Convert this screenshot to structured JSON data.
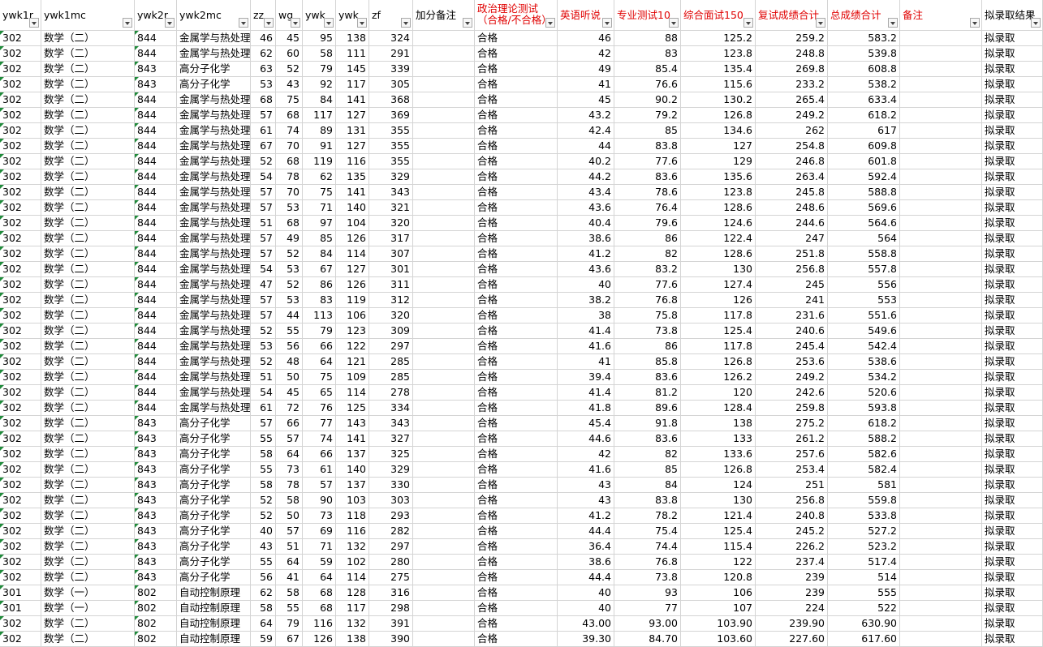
{
  "columns": [
    {
      "label": "ywk1r",
      "red": false
    },
    {
      "label": "ywk1mc",
      "red": false
    },
    {
      "label": "ywk2r",
      "red": false
    },
    {
      "label": "ywk2mc",
      "red": false
    },
    {
      "label": "zz",
      "red": false
    },
    {
      "label": "wg",
      "red": false
    },
    {
      "label": "ywk",
      "red": false
    },
    {
      "label": "ywk",
      "red": false
    },
    {
      "label": "zf",
      "red": false
    },
    {
      "label": "加分备注",
      "red": false
    },
    {
      "label": "政治理论测试（合格/不合格）",
      "red": true,
      "wrap": true
    },
    {
      "label": "英语听说",
      "red": true
    },
    {
      "label": "专业测试10",
      "red": true
    },
    {
      "label": "综合面试150",
      "red": true
    },
    {
      "label": "复试成绩合计",
      "red": true
    },
    {
      "label": "总成绩合计",
      "red": true
    },
    {
      "label": "备注",
      "red": true
    },
    {
      "label": "拟录取结果",
      "red": false
    }
  ],
  "rows": [
    [
      "302",
      "数学（二）",
      "844",
      "金属学与热处理",
      "46",
      "45",
      "95",
      "138",
      "324",
      "",
      "合格",
      "46",
      "88",
      "125.2",
      "259.2",
      "583.2",
      "",
      "拟录取"
    ],
    [
      "302",
      "数学（二）",
      "844",
      "金属学与热处理",
      "62",
      "60",
      "58",
      "111",
      "291",
      "",
      "合格",
      "42",
      "83",
      "123.8",
      "248.8",
      "539.8",
      "",
      "拟录取"
    ],
    [
      "302",
      "数学（二）",
      "843",
      "高分子化学",
      "63",
      "52",
      "79",
      "145",
      "339",
      "",
      "合格",
      "49",
      "85.4",
      "135.4",
      "269.8",
      "608.8",
      "",
      "拟录取"
    ],
    [
      "302",
      "数学（二）",
      "843",
      "高分子化学",
      "53",
      "43",
      "92",
      "117",
      "305",
      "",
      "合格",
      "41",
      "76.6",
      "115.6",
      "233.2",
      "538.2",
      "",
      "拟录取"
    ],
    [
      "302",
      "数学（二）",
      "844",
      "金属学与热处理",
      "68",
      "75",
      "84",
      "141",
      "368",
      "",
      "合格",
      "45",
      "90.2",
      "130.2",
      "265.4",
      "633.4",
      "",
      "拟录取"
    ],
    [
      "302",
      "数学（二）",
      "844",
      "金属学与热处理",
      "57",
      "68",
      "117",
      "127",
      "369",
      "",
      "合格",
      "43.2",
      "79.2",
      "126.8",
      "249.2",
      "618.2",
      "",
      "拟录取"
    ],
    [
      "302",
      "数学（二）",
      "844",
      "金属学与热处理",
      "61",
      "74",
      "89",
      "131",
      "355",
      "",
      "合格",
      "42.4",
      "85",
      "134.6",
      "262",
      "617",
      "",
      "拟录取"
    ],
    [
      "302",
      "数学（二）",
      "844",
      "金属学与热处理",
      "67",
      "70",
      "91",
      "127",
      "355",
      "",
      "合格",
      "44",
      "83.8",
      "127",
      "254.8",
      "609.8",
      "",
      "拟录取"
    ],
    [
      "302",
      "数学（二）",
      "844",
      "金属学与热处理",
      "52",
      "68",
      "119",
      "116",
      "355",
      "",
      "合格",
      "40.2",
      "77.6",
      "129",
      "246.8",
      "601.8",
      "",
      "拟录取"
    ],
    [
      "302",
      "数学（二）",
      "844",
      "金属学与热处理",
      "54",
      "78",
      "62",
      "135",
      "329",
      "",
      "合格",
      "44.2",
      "83.6",
      "135.6",
      "263.4",
      "592.4",
      "",
      "拟录取"
    ],
    [
      "302",
      "数学（二）",
      "844",
      "金属学与热处理",
      "57",
      "70",
      "75",
      "141",
      "343",
      "",
      "合格",
      "43.4",
      "78.6",
      "123.8",
      "245.8",
      "588.8",
      "",
      "拟录取"
    ],
    [
      "302",
      "数学（二）",
      "844",
      "金属学与热处理",
      "57",
      "53",
      "71",
      "140",
      "321",
      "",
      "合格",
      "43.6",
      "76.4",
      "128.6",
      "248.6",
      "569.6",
      "",
      "拟录取"
    ],
    [
      "302",
      "数学（二）",
      "844",
      "金属学与热处理",
      "51",
      "68",
      "97",
      "104",
      "320",
      "",
      "合格",
      "40.4",
      "79.6",
      "124.6",
      "244.6",
      "564.6",
      "",
      "拟录取"
    ],
    [
      "302",
      "数学（二）",
      "844",
      "金属学与热处理",
      "57",
      "49",
      "85",
      "126",
      "317",
      "",
      "合格",
      "38.6",
      "86",
      "122.4",
      "247",
      "564",
      "",
      "拟录取"
    ],
    [
      "302",
      "数学（二）",
      "844",
      "金属学与热处理",
      "57",
      "52",
      "84",
      "114",
      "307",
      "",
      "合格",
      "41.2",
      "82",
      "128.6",
      "251.8",
      "558.8",
      "",
      "拟录取"
    ],
    [
      "302",
      "数学（二）",
      "844",
      "金属学与热处理",
      "54",
      "53",
      "67",
      "127",
      "301",
      "",
      "合格",
      "43.6",
      "83.2",
      "130",
      "256.8",
      "557.8",
      "",
      "拟录取"
    ],
    [
      "302",
      "数学（二）",
      "844",
      "金属学与热处理",
      "47",
      "52",
      "86",
      "126",
      "311",
      "",
      "合格",
      "40",
      "77.6",
      "127.4",
      "245",
      "556",
      "",
      "拟录取"
    ],
    [
      "302",
      "数学（二）",
      "844",
      "金属学与热处理",
      "57",
      "53",
      "83",
      "119",
      "312",
      "",
      "合格",
      "38.2",
      "76.8",
      "126",
      "241",
      "553",
      "",
      "拟录取"
    ],
    [
      "302",
      "数学（二）",
      "844",
      "金属学与热处理",
      "57",
      "44",
      "113",
      "106",
      "320",
      "",
      "合格",
      "38",
      "75.8",
      "117.8",
      "231.6",
      "551.6",
      "",
      "拟录取"
    ],
    [
      "302",
      "数学（二）",
      "844",
      "金属学与热处理",
      "52",
      "55",
      "79",
      "123",
      "309",
      "",
      "合格",
      "41.4",
      "73.8",
      "125.4",
      "240.6",
      "549.6",
      "",
      "拟录取"
    ],
    [
      "302",
      "数学（二）",
      "844",
      "金属学与热处理",
      "53",
      "56",
      "66",
      "122",
      "297",
      "",
      "合格",
      "41.6",
      "86",
      "117.8",
      "245.4",
      "542.4",
      "",
      "拟录取"
    ],
    [
      "302",
      "数学（二）",
      "844",
      "金属学与热处理",
      "52",
      "48",
      "64",
      "121",
      "285",
      "",
      "合格",
      "41",
      "85.8",
      "126.8",
      "253.6",
      "538.6",
      "",
      "拟录取"
    ],
    [
      "302",
      "数学（二）",
      "844",
      "金属学与热处理",
      "51",
      "50",
      "75",
      "109",
      "285",
      "",
      "合格",
      "39.4",
      "83.6",
      "126.2",
      "249.2",
      "534.2",
      "",
      "拟录取"
    ],
    [
      "302",
      "数学（二）",
      "844",
      "金属学与热处理",
      "54",
      "45",
      "65",
      "114",
      "278",
      "",
      "合格",
      "41.4",
      "81.2",
      "120",
      "242.6",
      "520.6",
      "",
      "拟录取"
    ],
    [
      "302",
      "数学（二）",
      "844",
      "金属学与热处理",
      "61",
      "72",
      "76",
      "125",
      "334",
      "",
      "合格",
      "41.8",
      "89.6",
      "128.4",
      "259.8",
      "593.8",
      "",
      "拟录取"
    ],
    [
      "302",
      "数学（二）",
      "843",
      "高分子化学",
      "57",
      "66",
      "77",
      "143",
      "343",
      "",
      "合格",
      "45.4",
      "91.8",
      "138",
      "275.2",
      "618.2",
      "",
      "拟录取"
    ],
    [
      "302",
      "数学（二）",
      "843",
      "高分子化学",
      "55",
      "57",
      "74",
      "141",
      "327",
      "",
      "合格",
      "44.6",
      "83.6",
      "133",
      "261.2",
      "588.2",
      "",
      "拟录取"
    ],
    [
      "302",
      "数学（二）",
      "843",
      "高分子化学",
      "58",
      "64",
      "66",
      "137",
      "325",
      "",
      "合格",
      "42",
      "82",
      "133.6",
      "257.6",
      "582.6",
      "",
      "拟录取"
    ],
    [
      "302",
      "数学（二）",
      "843",
      "高分子化学",
      "55",
      "73",
      "61",
      "140",
      "329",
      "",
      "合格",
      "41.6",
      "85",
      "126.8",
      "253.4",
      "582.4",
      "",
      "拟录取"
    ],
    [
      "302",
      "数学（二）",
      "843",
      "高分子化学",
      "58",
      "78",
      "57",
      "137",
      "330",
      "",
      "合格",
      "43",
      "84",
      "124",
      "251",
      "581",
      "",
      "拟录取"
    ],
    [
      "302",
      "数学（二）",
      "843",
      "高分子化学",
      "52",
      "58",
      "90",
      "103",
      "303",
      "",
      "合格",
      "43",
      "83.8",
      "130",
      "256.8",
      "559.8",
      "",
      "拟录取"
    ],
    [
      "302",
      "数学（二）",
      "843",
      "高分子化学",
      "52",
      "50",
      "73",
      "118",
      "293",
      "",
      "合格",
      "41.2",
      "78.2",
      "121.4",
      "240.8",
      "533.8",
      "",
      "拟录取"
    ],
    [
      "302",
      "数学（二）",
      "843",
      "高分子化学",
      "40",
      "57",
      "69",
      "116",
      "282",
      "",
      "合格",
      "44.4",
      "75.4",
      "125.4",
      "245.2",
      "527.2",
      "",
      "拟录取"
    ],
    [
      "302",
      "数学（二）",
      "843",
      "高分子化学",
      "43",
      "51",
      "71",
      "132",
      "297",
      "",
      "合格",
      "36.4",
      "74.4",
      "115.4",
      "226.2",
      "523.2",
      "",
      "拟录取"
    ],
    [
      "302",
      "数学（二）",
      "843",
      "高分子化学",
      "55",
      "64",
      "59",
      "102",
      "280",
      "",
      "合格",
      "38.6",
      "76.8",
      "122",
      "237.4",
      "517.4",
      "",
      "拟录取"
    ],
    [
      "302",
      "数学（二）",
      "843",
      "高分子化学",
      "56",
      "41",
      "64",
      "114",
      "275",
      "",
      "合格",
      "44.4",
      "73.8",
      "120.8",
      "239",
      "514",
      "",
      "拟录取"
    ],
    [
      "301",
      "数学（一）",
      "802",
      "自动控制原理",
      "62",
      "58",
      "68",
      "128",
      "316",
      "",
      "合格",
      "40",
      "93",
      "106",
      "239",
      "555",
      "",
      "拟录取"
    ],
    [
      "301",
      "数学（一）",
      "802",
      "自动控制原理",
      "58",
      "55",
      "68",
      "117",
      "298",
      "",
      "合格",
      "40",
      "77",
      "107",
      "224",
      "522",
      "",
      "拟录取"
    ],
    [
      "302",
      "数学（二）",
      "802",
      "自动控制原理",
      "64",
      "79",
      "116",
      "132",
      "391",
      "",
      "合格",
      "43.00",
      "93.00",
      "103.90",
      "239.90",
      "630.90",
      "",
      "拟录取"
    ],
    [
      "302",
      "数学（二）",
      "802",
      "自动控制原理",
      "59",
      "67",
      "126",
      "138",
      "390",
      "",
      "合格",
      "39.30",
      "84.70",
      "103.60",
      "227.60",
      "617.60",
      "",
      "拟录取"
    ]
  ]
}
